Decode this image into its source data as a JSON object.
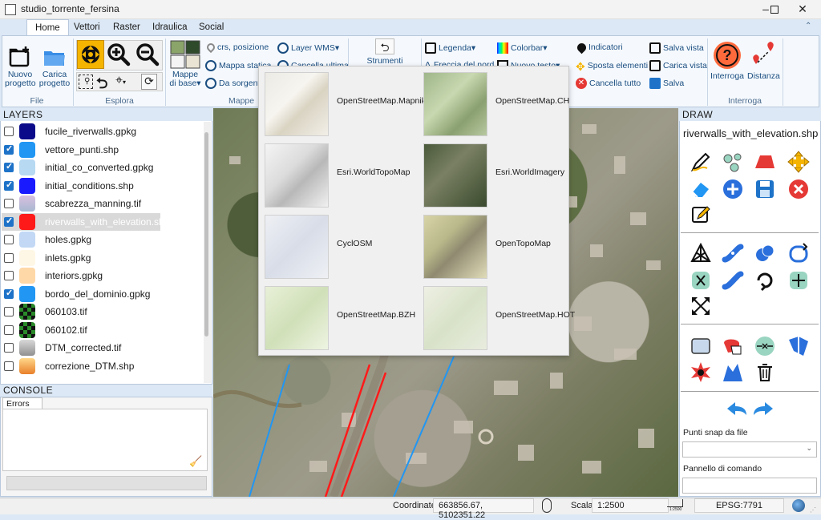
{
  "window": {
    "title": "studio_torrente_fersina"
  },
  "ribbon": {
    "tabs": [
      "Home",
      "Vettori",
      "Raster",
      "Idraulica",
      "Social"
    ],
    "groups": {
      "file": "File",
      "explore": "Esplora",
      "maps": "Mappe o",
      "query": "Interroga"
    },
    "file": {
      "new_project": "Nuovo progetto",
      "load_project": "Carica progetto"
    },
    "maps": {
      "base_maps": "Mappe di base",
      "crs_position": "crs, posizione",
      "static_map": "Mappa statica",
      "from_source": "Da sorgente",
      "wms_layer": "Layer WMS",
      "delete_last": "Cancella ultima"
    },
    "main_tools": "Strumenti principali",
    "annotate": {
      "legend": "Legenda",
      "north_arrow": "Freccia del nord",
      "colorbar": "Colorbar",
      "new_text": "Nuovo testo",
      "indicators": "Indicatori",
      "move_elements": "Sposta elementi",
      "delete_all": "Cancella tutto",
      "save_view": "Salva vista",
      "load_view": "Carica vista",
      "save": "Salva"
    },
    "query": {
      "query": "Interroga",
      "distance": "Distanza"
    }
  },
  "layers": {
    "title": "LAYERS",
    "items": [
      {
        "name": "fucile_riverwalls.gpkg",
        "checked": false,
        "color": "#0a0a8a"
      },
      {
        "name": "vettore_punti.shp",
        "checked": true,
        "color": "#2196f3"
      },
      {
        "name": "initial_co_converted.gpkg",
        "checked": true,
        "color": "#b7d9f2"
      },
      {
        "name": "initial_conditions.shp",
        "checked": true,
        "color": "#1a1aff"
      },
      {
        "name": "scabrezza_manning.tif",
        "checked": false,
        "color": "#b8a8c8"
      },
      {
        "name": "riverwalls_with_elevation.shp",
        "checked": true,
        "color": "#ff1a1a",
        "selected": true
      },
      {
        "name": "holes.gpkg",
        "checked": false,
        "color": "#c2d8f5"
      },
      {
        "name": "inlets.gpkg",
        "checked": false,
        "color": "#fff7e6"
      },
      {
        "name": "interiors.gpkg",
        "checked": false,
        "color": "#ffd8a8"
      },
      {
        "name": "bordo_del_dominio.gpkg",
        "checked": true,
        "color": "#2196f3"
      },
      {
        "name": "060103.tif",
        "checked": false,
        "color": "#2a8a2a"
      },
      {
        "name": "060102.tif",
        "checked": false,
        "color": "#2a8a2a"
      },
      {
        "name": "DTM_corrected.tif",
        "checked": false,
        "color": "#b0b0b0"
      },
      {
        "name": "correzione_DTM.shp",
        "checked": false,
        "color": "#e8802a"
      }
    ]
  },
  "console": {
    "title": "CONSOLE",
    "tab": "Errors log"
  },
  "basemaps": [
    {
      "name": "OpenStreetMap.Mapnik"
    },
    {
      "name": "OpenStreetMap.CH"
    },
    {
      "name": "Esri.WorldTopoMap"
    },
    {
      "name": "Esri.WorldImagery"
    },
    {
      "name": "CyclOSM"
    },
    {
      "name": "OpenTopoMap"
    },
    {
      "name": "OpenStreetMap.BZH"
    },
    {
      "name": "OpenStreetMap.HOT"
    }
  ],
  "draw": {
    "title": "DRAW",
    "layer_name": "riverwalls_with_elevation.shp",
    "snap_label": "Punti snap da file",
    "command_label": "Pannello di comando"
  },
  "status": {
    "coords_label": "Coordinate",
    "coords_value": "663856.67, 5102351.22",
    "scale_label": "Scala",
    "scale_value": "1:2500",
    "scale_bar_label": "1:2500",
    "epsg": "EPSG:7791"
  }
}
